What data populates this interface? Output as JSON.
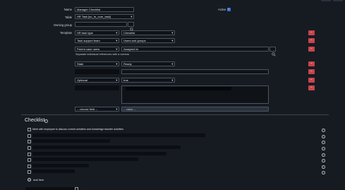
{
  "header": {
    "buttons": [
      "",
      ""
    ]
  },
  "form": {
    "name_label": "Name",
    "name_value": "Manager Checklist",
    "active_label": "Active",
    "active_checked": true,
    "table_label": "Table",
    "table_value": "HR Task [sn_hr_core_task]",
    "owning_group_label": "Owning group",
    "owning_group_value": "",
    "template_label": "Template",
    "template_rows": [
      {
        "field": "HR task type",
        "value": "Checklist"
      },
      {
        "field": "Task support team",
        "value": "Users and groups"
      },
      {
        "field": "Parent case users",
        "value": "Assigned to"
      }
    ],
    "separate_note": "Separate individual references with a comma",
    "state_field": "State",
    "state_value": "Ready",
    "optional_field": "Optional",
    "optional_value": "true",
    "choose_field_placeholder": "-- choose field --",
    "value_placeholder": "-- value --"
  },
  "checklist": {
    "title": "Checklist",
    "first_item": "Meet with employee to discuss current activities and knowledge transfer activities",
    "add_item_label": "Add Item"
  },
  "icons": {
    "remove": "minus-icon",
    "lookup": "search-icon",
    "info": "info-icon",
    "add": "plus-circle-icon"
  },
  "colors": {
    "background": "#161b22",
    "remove_button": "#c8444b",
    "checkbox_active": "#3b6fd1"
  }
}
